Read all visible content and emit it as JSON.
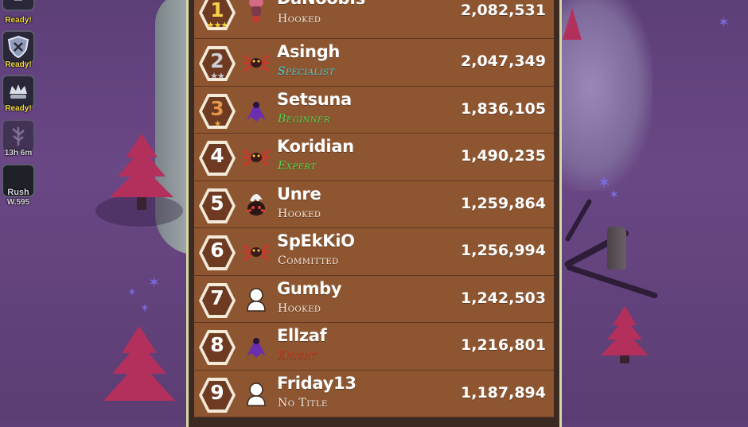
{
  "side_buttons": [
    {
      "icon": "sword-icon",
      "label": "Ready!"
    },
    {
      "icon": "shield-icon",
      "label": "Ready!"
    },
    {
      "icon": "crown-hand-icon",
      "label": "Ready!"
    },
    {
      "icon": "tree-icon",
      "label": "13h 6m"
    },
    {
      "icon": "rush-icon",
      "label": "Rush",
      "sublabel": "W.595"
    }
  ],
  "leaderboard": {
    "rows": [
      {
        "rank": "1",
        "stars": "★★★",
        "star_color": "#f2d03c",
        "badge_color": "#6e3a22",
        "num_color": "#f6d24a",
        "avatar": "pink-creature-icon",
        "name": "DaNoobIs",
        "title": "Hooked",
        "title_color": "#f3e9de",
        "score": "2,082,531"
      },
      {
        "rank": "2",
        "stars": "★★",
        "star_color": "#c9c9cf",
        "badge_color": "#6e3a22",
        "num_color": "#cfcfd6",
        "avatar": "spider-crab-icon",
        "name": "Asingh",
        "title": "Specialist",
        "title_color": "#3fd7de",
        "score": "2,047,349"
      },
      {
        "rank": "3",
        "stars": "★",
        "star_color": "#e1a44a",
        "badge_color": "#6e3a22",
        "num_color": "#e2964a",
        "avatar": "purple-bat-icon",
        "name": "Setsuna",
        "title": "Beginner",
        "title_color": "#52d64c",
        "score": "1,836,105"
      },
      {
        "rank": "4",
        "stars": "",
        "star_color": "#ffffff",
        "badge_color": "#6e3a22",
        "num_color": "#ffffff",
        "avatar": "spider-crab-icon",
        "name": "Koridian",
        "title": "Expert",
        "title_color": "#4ee04a",
        "score": "1,490,235"
      },
      {
        "rank": "5",
        "stars": "",
        "star_color": "#ffffff",
        "badge_color": "#6e3a22",
        "num_color": "#ffffff",
        "avatar": "egg-creature-icon",
        "name": "Unre",
        "title": "Hooked",
        "title_color": "#f3e9de",
        "score": "1,259,864"
      },
      {
        "rank": "6",
        "stars": "",
        "star_color": "#ffffff",
        "badge_color": "#6e3a22",
        "num_color": "#ffffff",
        "avatar": "spider-crab-icon",
        "name": "SpEkKiO",
        "title": "Committed",
        "title_color": "#f3e9de",
        "score": "1,256,994"
      },
      {
        "rank": "7",
        "stars": "",
        "star_color": "#ffffff",
        "badge_color": "#6e3a22",
        "num_color": "#ffffff",
        "avatar": "default-user-icon",
        "name": "Gumby",
        "title": "Hooked",
        "title_color": "#f3e9de",
        "score": "1,242,503"
      },
      {
        "rank": "8",
        "stars": "",
        "star_color": "#ffffff",
        "badge_color": "#6e3a22",
        "num_color": "#ffffff",
        "avatar": "purple-bat-icon",
        "name": "Ellzaf",
        "title": "Knight",
        "title_color": "#d0381c",
        "score": "1,216,801"
      },
      {
        "rank": "9",
        "stars": "",
        "star_color": "#ffffff",
        "badge_color": "#6e3a22",
        "num_color": "#ffffff",
        "avatar": "default-user-icon",
        "name": "Friday13",
        "title": "No Title",
        "title_color": "#f3e9de",
        "score": "1,187,894"
      }
    ]
  },
  "colors": {
    "panel_border": "#d7d9a4",
    "row_bg": "#8e5531",
    "ready_text": "#f0d840",
    "background": "#6a4785"
  }
}
